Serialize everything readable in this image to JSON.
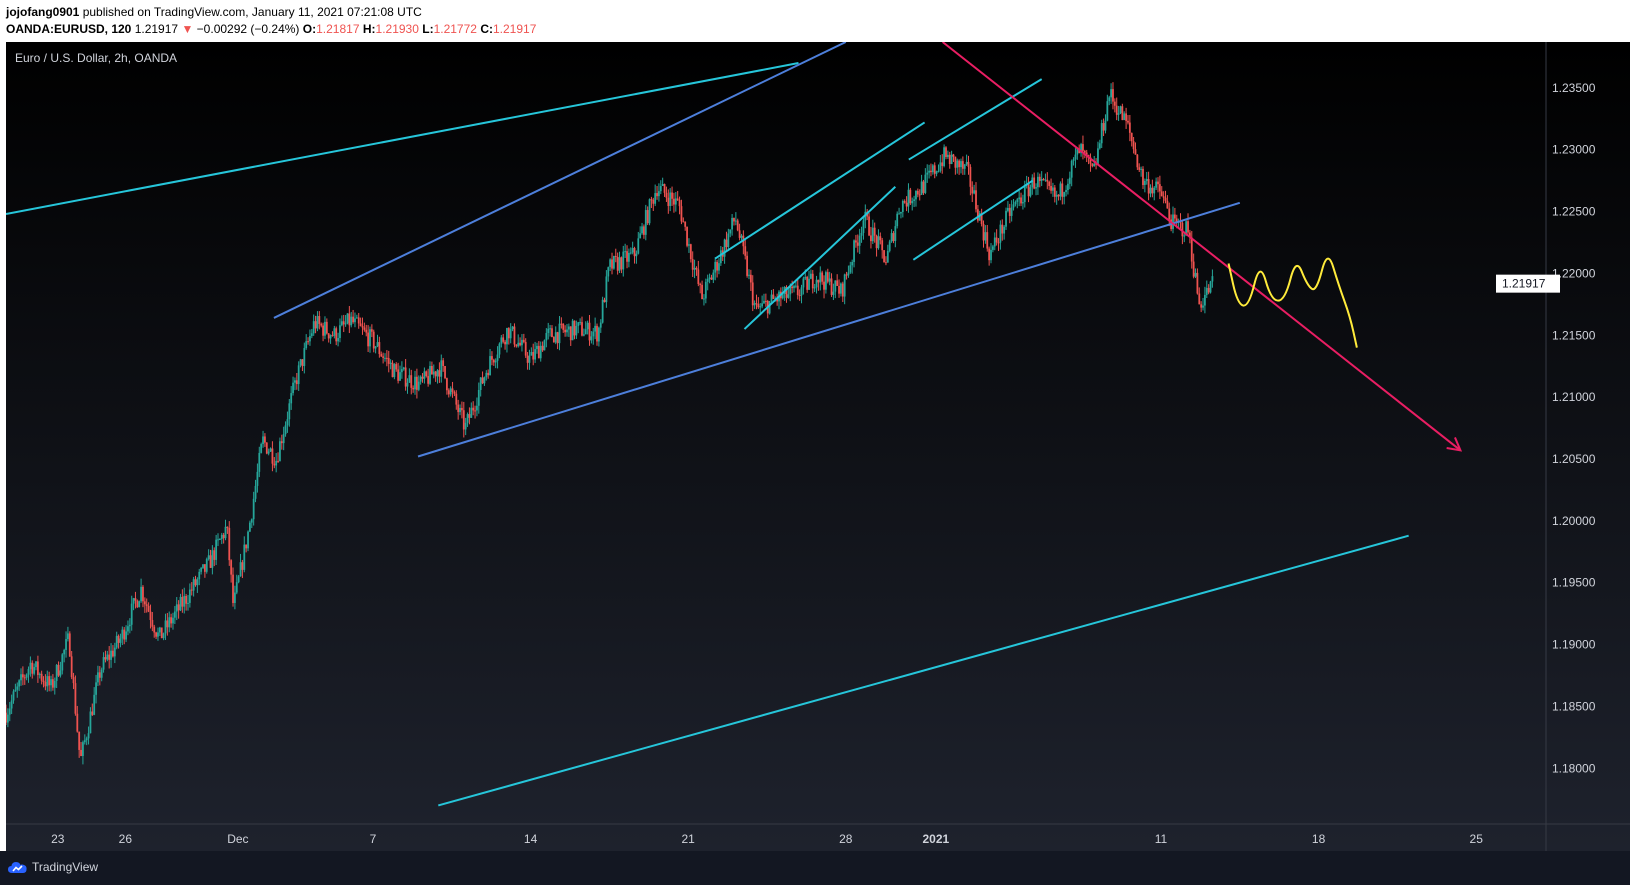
{
  "header": {
    "author": "jojofang0901",
    "published_text": "published on TradingView.com, January 11, 2021 07:21:08 UTC",
    "symbol": "OANDA:EURUSD, 120",
    "last": "1.21917",
    "arrow": "▼",
    "change": "−0.00292 (−0.24%)",
    "o_label": "O:",
    "o_value": "1.21817",
    "h_label": "H:",
    "h_value": "1.21930",
    "l_label": "L:",
    "l_value": "1.21772",
    "c_label": "C:",
    "c_value": "1.21917"
  },
  "footer": {
    "brand": "TradingView"
  },
  "colors": {
    "bg_top": "#000000",
    "bg_bottom": "#1e222d",
    "up": "#26a69a",
    "down": "#ef5350",
    "cyan_line": "#26c6da",
    "blue_line": "#4d7fdb",
    "red_arrow": "#e91e63",
    "yellow_scribble": "#ffeb3b",
    "axis_text": "#d1d4dc",
    "price_tag_bg": "#ffffff",
    "price_tag_text": "#131722"
  },
  "chart_data": {
    "type": "candlestick",
    "title": "Euro / U.S. Dollar, 2h, OANDA",
    "x_tick_labels": [
      "23",
      "26",
      "Dec",
      "7",
      "14",
      "21",
      "28",
      "2021",
      "11",
      "18",
      "25"
    ],
    "x_tick_days": [
      -8,
      -5,
      0,
      6,
      13,
      20,
      27,
      31,
      41,
      48,
      55
    ],
    "x_axis_origin": "2020-12-01",
    "y_ticks": [
      "1.23500",
      "1.23000",
      "1.22500",
      "1.22000",
      "1.21500",
      "1.21000",
      "1.20500",
      "1.20000",
      "1.19500",
      "1.19000",
      "1.18500",
      "1.18000"
    ],
    "ylim": [
      1.1755,
      1.2387
    ],
    "xlim_days": [
      -10.3,
      58.1
    ],
    "last_price": "1.21917",
    "price_path": [
      [
        -10.3,
        1.1845
      ],
      [
        -9.2,
        1.1885
      ],
      [
        -8.3,
        1.1865
      ],
      [
        -7.5,
        1.1905
      ],
      [
        -7.0,
        1.1805
      ],
      [
        -6.1,
        1.188
      ],
      [
        -5.2,
        1.1905
      ],
      [
        -4.3,
        1.1945
      ],
      [
        -3.5,
        1.1905
      ],
      [
        -2.4,
        1.1935
      ],
      [
        -1.3,
        1.1965
      ],
      [
        -0.5,
        1.1995
      ],
      [
        -0.2,
        1.193
      ],
      [
        0.5,
        1.1995
      ],
      [
        1.1,
        1.2065
      ],
      [
        1.7,
        1.205
      ],
      [
        2.6,
        1.2115
      ],
      [
        3.4,
        1.216
      ],
      [
        4.3,
        1.215
      ],
      [
        5.0,
        1.2162
      ],
      [
        6.0,
        1.2145
      ],
      [
        7.0,
        1.212
      ],
      [
        8.1,
        1.211
      ],
      [
        9.0,
        1.2125
      ],
      [
        10.1,
        1.2075
      ],
      [
        11.1,
        1.2125
      ],
      [
        12.0,
        1.2155
      ],
      [
        13.0,
        1.213
      ],
      [
        13.8,
        1.215
      ],
      [
        15.1,
        1.2155
      ],
      [
        16.0,
        1.2152
      ],
      [
        16.5,
        1.2205
      ],
      [
        17.6,
        1.2215
      ],
      [
        18.6,
        1.227
      ],
      [
        19.6,
        1.2255
      ],
      [
        20.6,
        1.218
      ],
      [
        21.1,
        1.22
      ],
      [
        22.1,
        1.2245
      ],
      [
        23.0,
        1.217
      ],
      [
        24.0,
        1.218
      ],
      [
        24.9,
        1.2185
      ],
      [
        25.7,
        1.2198
      ],
      [
        26.8,
        1.2185
      ],
      [
        27.8,
        1.2245
      ],
      [
        28.8,
        1.221
      ],
      [
        29.4,
        1.2255
      ],
      [
        30.4,
        1.227
      ],
      [
        31.4,
        1.2295
      ],
      [
        32.4,
        1.2282
      ],
      [
        33.4,
        1.2215
      ],
      [
        34.3,
        1.225
      ],
      [
        35.4,
        1.2275
      ],
      [
        36.4,
        1.226
      ],
      [
        37.4,
        1.23
      ],
      [
        38.0,
        1.228
      ],
      [
        38.7,
        1.2345
      ],
      [
        39.5,
        1.232
      ],
      [
        40.2,
        1.2275
      ],
      [
        41.0,
        1.2265
      ],
      [
        41.5,
        1.224
      ],
      [
        42.2,
        1.2235
      ],
      [
        42.7,
        1.2175
      ],
      [
        43.3,
        1.2192
      ]
    ],
    "drawings": {
      "cyan_outer_upper": [
        [
          -10.3,
          1.2248
        ],
        [
          24.9,
          1.237
        ]
      ],
      "cyan_outer_lower": [
        [
          8.9,
          1.177
        ],
        [
          52.0,
          1.1988
        ]
      ],
      "blue_upper": [
        [
          1.6,
          1.2164
        ],
        [
          27.0,
          1.2387
        ]
      ],
      "blue_lower": [
        [
          8.0,
          1.2052
        ],
        [
          44.5,
          1.2257
        ]
      ],
      "cyan_channel_1_top": [
        [
          21.2,
          1.2212
        ],
        [
          30.5,
          1.2322
        ]
      ],
      "cyan_channel_1_bottom": [
        [
          22.5,
          1.2155
        ],
        [
          29.2,
          1.227
        ]
      ],
      "cyan_channel_2_top": [
        [
          29.8,
          1.2292
        ],
        [
          35.7,
          1.2357
        ]
      ],
      "cyan_channel_2_bottom": [
        [
          30.0,
          1.2211
        ],
        [
          35.3,
          1.2275
        ]
      ],
      "red_arrow": [
        [
          31.3,
          1.2387
        ],
        [
          54.3,
          1.2057
        ]
      ],
      "yellow_scribble": [
        [
          44.0,
          1.2208
        ],
        [
          44.4,
          1.2175
        ],
        [
          44.9,
          1.2173
        ],
        [
          45.4,
          1.221
        ],
        [
          45.9,
          1.2178
        ],
        [
          46.5,
          1.2178
        ],
        [
          47.0,
          1.2213
        ],
        [
          47.5,
          1.219
        ],
        [
          47.9,
          1.2185
        ],
        [
          48.4,
          1.222
        ],
        [
          48.9,
          1.219
        ],
        [
          49.4,
          1.2165
        ],
        [
          49.7,
          1.214
        ]
      ]
    }
  }
}
